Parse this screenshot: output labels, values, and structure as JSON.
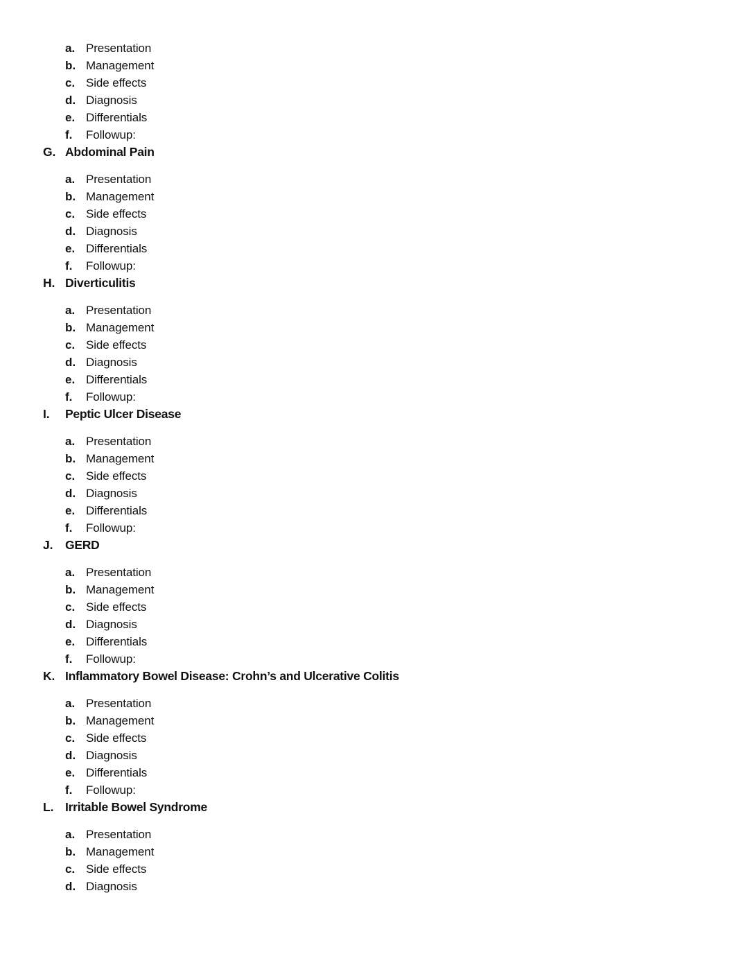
{
  "document": {
    "type": "outline-continuation",
    "page_background": "#ffffff",
    "text_color": "#111111",
    "sub_item_labels": {
      "a": "Presentation",
      "b": "Management",
      "c": "Side effects",
      "d": "Diagnosis",
      "e": "Differentials",
      "f": "Followup:"
    },
    "orphan_sub_items": [
      {
        "marker": "a.",
        "label": "Presentation"
      },
      {
        "marker": "b.",
        "label": "Management"
      },
      {
        "marker": "c.",
        "label": "Side effects"
      },
      {
        "marker": "d.",
        "label": "Diagnosis"
      },
      {
        "marker": "e.",
        "label": "Differentials"
      },
      {
        "marker": "f.",
        "label": "Followup:"
      }
    ],
    "sections": [
      {
        "marker": "G.",
        "title": "Abdominal Pain",
        "items": [
          {
            "marker": "a.",
            "label": "Presentation"
          },
          {
            "marker": "b.",
            "label": "Management"
          },
          {
            "marker": "c.",
            "label": "Side effects"
          },
          {
            "marker": "d.",
            "label": "Diagnosis"
          },
          {
            "marker": "e.",
            "label": "Differentials"
          },
          {
            "marker": "f.",
            "label": "Followup:"
          }
        ]
      },
      {
        "marker": "H.",
        "title": "Diverticulitis",
        "items": [
          {
            "marker": "a.",
            "label": "Presentation"
          },
          {
            "marker": "b.",
            "label": "Management"
          },
          {
            "marker": "c.",
            "label": "Side effects"
          },
          {
            "marker": "d.",
            "label": "Diagnosis"
          },
          {
            "marker": "e.",
            "label": "Differentials"
          },
          {
            "marker": "f.",
            "label": "Followup:"
          }
        ]
      },
      {
        "marker": "I.",
        "title": "Peptic Ulcer Disease",
        "items": [
          {
            "marker": "a.",
            "label": "Presentation"
          },
          {
            "marker": "b.",
            "label": "Management"
          },
          {
            "marker": "c.",
            "label": "Side effects"
          },
          {
            "marker": "d.",
            "label": "Diagnosis"
          },
          {
            "marker": "e.",
            "label": "Differentials"
          },
          {
            "marker": "f.",
            "label": "Followup:"
          }
        ]
      },
      {
        "marker": "J.",
        "title": "GERD",
        "items": [
          {
            "marker": "a.",
            "label": "Presentation"
          },
          {
            "marker": "b.",
            "label": "Management"
          },
          {
            "marker": "c.",
            "label": "Side effects"
          },
          {
            "marker": "d.",
            "label": "Diagnosis"
          },
          {
            "marker": "e.",
            "label": "Differentials"
          },
          {
            "marker": "f.",
            "label": "Followup:"
          }
        ]
      },
      {
        "marker": "K.",
        "title": "Inflammatory Bowel Disease: Crohn’s and Ulcerative Colitis",
        "items": [
          {
            "marker": "a.",
            "label": "Presentation"
          },
          {
            "marker": "b.",
            "label": "Management"
          },
          {
            "marker": "c.",
            "label": "Side effects"
          },
          {
            "marker": "d.",
            "label": "Diagnosis"
          },
          {
            "marker": "e.",
            "label": "Differentials"
          },
          {
            "marker": "f.",
            "label": "Followup:"
          }
        ]
      },
      {
        "marker": "L.",
        "title": "Irritable Bowel Syndrome",
        "items": [
          {
            "marker": "a.",
            "label": "Presentation"
          },
          {
            "marker": "b.",
            "label": "Management"
          },
          {
            "marker": "c.",
            "label": "Side effects"
          },
          {
            "marker": "d.",
            "label": "Diagnosis"
          }
        ]
      }
    ]
  }
}
